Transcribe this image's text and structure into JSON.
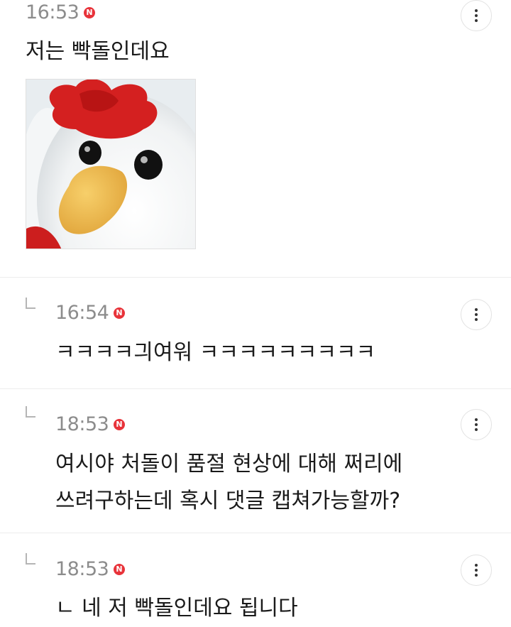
{
  "comments": [
    {
      "time": "16:53",
      "badge": "N",
      "text": "저는 빡돌인데요",
      "is_reply": false,
      "has_image": true,
      "image_icon": "white-rooster-plush-photo"
    },
    {
      "time": "16:54",
      "badge": "N",
      "text": "ㅋㅋㅋㅋ긔여워 ㅋㅋㅋㅋㅋㅋㅋㅋㅋ",
      "is_reply": true
    },
    {
      "time": "18:53",
      "badge": "N",
      "text_line1": "여시야 처돌이 품절 현상에 대해 쩌리에",
      "text_line2": "쓰려구하는데 혹시 댓글 캡쳐가능할까?",
      "is_reply": true
    },
    {
      "time": "18:53",
      "badge": "N",
      "text": "ㄴ 네 저 빡돌인데요 됩니다",
      "is_reply": true
    }
  ],
  "icons": {
    "more": "more-vertical-icon",
    "reply": "reply-arrow-icon",
    "new": "new-badge-icon"
  },
  "colors": {
    "badge": "#e8333a",
    "time": "#8c8c8c",
    "band": "#f7f7f7"
  }
}
